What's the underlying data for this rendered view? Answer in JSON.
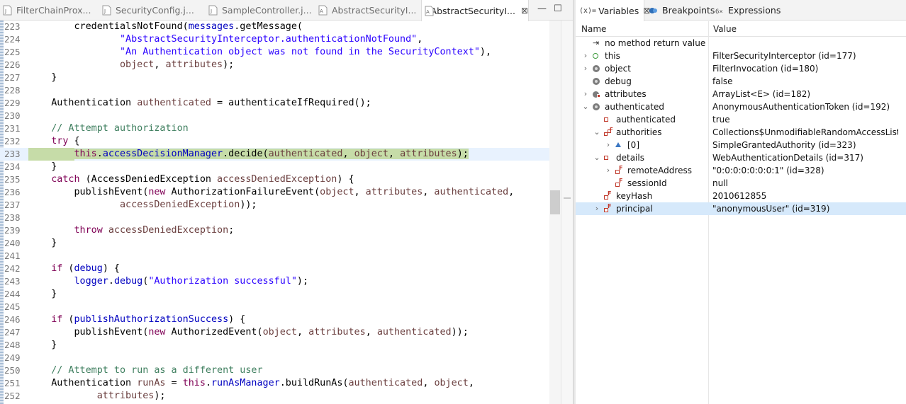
{
  "editor": {
    "tabs": [
      {
        "label": "FilterChainProx...",
        "icon": "java-class-icon",
        "active": false
      },
      {
        "label": "SecurityConfig.j...",
        "icon": "java-file-icon",
        "active": false
      },
      {
        "label": "SampleController.j...",
        "icon": "java-file-icon",
        "active": false
      },
      {
        "label": "AbstractSecurityI...",
        "icon": "java-abstract-class-icon",
        "active": false
      },
      {
        "label": "AbstractSecurityI...",
        "icon": "java-abstract-class-icon",
        "active": true
      }
    ],
    "tab_close_glyph": "⊠",
    "minimize_glyph": "—",
    "maximize_glyph": "☐",
    "lines": [
      {
        "no": "223",
        "code": "        credentialsNotFound(messages.getMessage("
      },
      {
        "no": "224",
        "code": "                \"AbstractSecurityInterceptor.authenticationNotFound\","
      },
      {
        "no": "225",
        "code": "                \"An Authentication object was not found in the SecurityContext\"),"
      },
      {
        "no": "226",
        "code": "                object, attributes);"
      },
      {
        "no": "227",
        "code": "    }"
      },
      {
        "no": "228",
        "code": ""
      },
      {
        "no": "229",
        "code": "    Authentication authenticated = authenticateIfRequired();"
      },
      {
        "no": "230",
        "code": ""
      },
      {
        "no": "231",
        "code": "    // Attempt authorization"
      },
      {
        "no": "232",
        "code": "    try {"
      },
      {
        "no": "233",
        "code": "        this.accessDecisionManager.decide(authenticated, object, attributes);"
      },
      {
        "no": "234",
        "code": "    }"
      },
      {
        "no": "235",
        "code": "    catch (AccessDeniedException accessDeniedException) {"
      },
      {
        "no": "236",
        "code": "        publishEvent(new AuthorizationFailureEvent(object, attributes, authenticated,"
      },
      {
        "no": "237",
        "code": "                accessDeniedException));"
      },
      {
        "no": "238",
        "code": ""
      },
      {
        "no": "239",
        "code": "        throw accessDeniedException;"
      },
      {
        "no": "240",
        "code": "    }"
      },
      {
        "no": "241",
        "code": ""
      },
      {
        "no": "242",
        "code": "    if (debug) {"
      },
      {
        "no": "243",
        "code": "        logger.debug(\"Authorization successful\");"
      },
      {
        "no": "244",
        "code": "    }"
      },
      {
        "no": "245",
        "code": ""
      },
      {
        "no": "246",
        "code": "    if (publishAuthorizationSuccess) {"
      },
      {
        "no": "247",
        "code": "        publishEvent(new AuthorizedEvent(object, attributes, authenticated));"
      },
      {
        "no": "248",
        "code": "    }"
      },
      {
        "no": "249",
        "code": ""
      },
      {
        "no": "250",
        "code": "    // Attempt to run as a different user"
      },
      {
        "no": "251",
        "code": "    Authentication runAs = this.runAsManager.buildRunAs(authenticated, object,"
      },
      {
        "no": "252",
        "code": "            attributes);"
      }
    ],
    "highlighted_line": "233",
    "colors": {
      "keyword": "#7f0055",
      "string": "#2a00ff",
      "comment": "#3f7f5f",
      "field": "#0000c0",
      "local": "#6a3e3e",
      "current_line_bg": "#e8f2fe",
      "highlight_bg": "#c6dca8"
    }
  },
  "views": {
    "tabs": [
      {
        "label": "Variables",
        "icon_text": "(x)=",
        "icon": "variables-icon",
        "active": true
      },
      {
        "label": "Breakpoints",
        "icon": "breakpoints-icon",
        "active": false
      },
      {
        "label": "Expressions",
        "icon": "expressions-icon",
        "active": false
      }
    ],
    "close_glyph": "⊠"
  },
  "variables": {
    "columns": {
      "name": "Name",
      "value": "Value"
    },
    "rows": [
      {
        "name": "no method return value",
        "value": "",
        "icon": "return-value-icon",
        "expander": "",
        "depth": 0
      },
      {
        "name": "this",
        "value": "FilterSecurityInterceptor  (id=177)",
        "icon": "local-variable-icon",
        "expander": "›",
        "depth": 0
      },
      {
        "name": "object",
        "value": "FilterInvocation  (id=180)",
        "icon": "local-variable-icon",
        "expander": "›",
        "depth": 0
      },
      {
        "name": "debug",
        "value": "false",
        "icon": "local-variable-icon",
        "expander": "",
        "depth": 0
      },
      {
        "name": "attributes",
        "value": "ArrayList<E>  (id=182)",
        "icon": "local-variable-icon",
        "expander": "›",
        "depth": 0
      },
      {
        "name": "authenticated",
        "value": "AnonymousAuthenticationToken  (id=192)",
        "icon": "local-variable-icon",
        "expander": "⌄",
        "depth": 0
      },
      {
        "name": "authenticated",
        "value": "true",
        "icon": "private-field-icon",
        "expander": "",
        "depth": 1
      },
      {
        "name": "authorities",
        "value": "Collections$UnmodifiableRandomAccessList<E>",
        "icon": "final-field-icon",
        "expander": "⌄",
        "depth": 1
      },
      {
        "name": "[0]",
        "value": "SimpleGrantedAuthority  (id=323)",
        "icon": "element-icon",
        "expander": "›",
        "depth": 2
      },
      {
        "name": "details",
        "value": "WebAuthenticationDetails  (id=317)",
        "icon": "private-field-icon",
        "expander": "⌄",
        "depth": 1
      },
      {
        "name": "remoteAddress",
        "value": "\"0:0:0:0:0:0:0:1\" (id=328)",
        "icon": "final-field-icon",
        "expander": "›",
        "depth": 2
      },
      {
        "name": "sessionId",
        "value": "null",
        "icon": "final-field-icon",
        "expander": "",
        "depth": 2
      },
      {
        "name": "keyHash",
        "value": "2010612855",
        "icon": "final-field-icon",
        "expander": "",
        "depth": 1
      },
      {
        "name": "principal",
        "value": "\"anonymousUser\" (id=319)",
        "icon": "final-field-icon",
        "expander": "›",
        "depth": 1
      }
    ],
    "selected_row": "principal"
  }
}
